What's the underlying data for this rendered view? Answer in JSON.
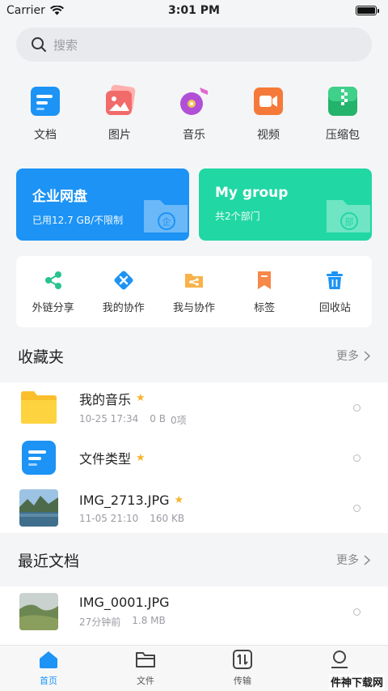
{
  "status": {
    "carrier": "Carrier",
    "time": "3:01 PM"
  },
  "search": {
    "placeholder": "搜索"
  },
  "categories": [
    {
      "label": "文档",
      "icon": "document-icon",
      "color": "#1c93f5"
    },
    {
      "label": "图片",
      "icon": "image-icon",
      "color": "#f26b6b"
    },
    {
      "label": "音乐",
      "icon": "music-icon",
      "color": "#b14fd6"
    },
    {
      "label": "视频",
      "icon": "video-icon",
      "color": "#f57a3a"
    },
    {
      "label": "压缩包",
      "icon": "archive-icon",
      "color": "#24b36b"
    }
  ],
  "drives": {
    "enterprise": {
      "title": "企业网盘",
      "subtitle": "已用12.7 GB/不限制",
      "color": "#1c93f5",
      "badge": "企"
    },
    "group": {
      "title": "My group",
      "subtitle": "共2个部门",
      "color": "#21d7a4",
      "badge": "部"
    }
  },
  "tools": [
    {
      "label": "外链分享",
      "icon": "share-link-icon"
    },
    {
      "label": "我的协作",
      "icon": "my-collab-icon"
    },
    {
      "label": "我与协作",
      "icon": "shared-folder-icon"
    },
    {
      "label": "标签",
      "icon": "bookmark-icon"
    },
    {
      "label": "回收站",
      "icon": "trash-icon"
    }
  ],
  "favorites": {
    "title": "收藏夹",
    "more": "更多",
    "items": [
      {
        "name": "我的音乐",
        "meta1": "10-25 17:34",
        "meta2": "0 B",
        "meta3": "0项",
        "starred": true,
        "type": "folder"
      },
      {
        "name": "文件类型",
        "starred": true,
        "type": "doc"
      },
      {
        "name": "IMG_2713.JPG",
        "meta1": "11-05 21:10",
        "meta2": "160 KB",
        "starred": true,
        "type": "photo"
      }
    ]
  },
  "recent": {
    "title": "最近文档",
    "more": "更多",
    "items": [
      {
        "name": "IMG_0001.JPG",
        "meta1": "27分钟前",
        "meta2": "1.8 MB",
        "type": "photo2"
      }
    ]
  },
  "tabs": [
    {
      "label": "首页",
      "icon": "home-icon",
      "active": true
    },
    {
      "label": "文件",
      "icon": "folder-icon",
      "active": false
    },
    {
      "label": "传输",
      "icon": "transfer-icon",
      "active": false
    },
    {
      "label": "我的",
      "icon": "profile-icon",
      "active": false
    }
  ],
  "watermark": "件神下载网"
}
